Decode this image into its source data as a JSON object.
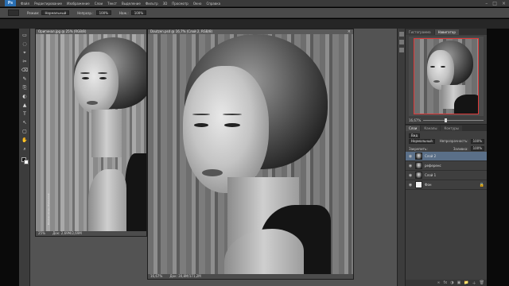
{
  "app": {
    "logo": "Ps",
    "menu": [
      "Файл",
      "Редактирование",
      "Изображение",
      "Слои",
      "Текст",
      "Выделение",
      "Фильтр",
      "3D",
      "Просмотр",
      "Окно",
      "Справка"
    ],
    "window_controls": [
      "–",
      "□",
      "×"
    ]
  },
  "options": {
    "mode_label": "Режим:",
    "mode_value": "Нормальный",
    "opacity_label": "Непрозр.:",
    "opacity_value": "100%",
    "pressure_label": "Наж.:",
    "flow_value": "100%"
  },
  "tools": [
    "▭",
    "◌",
    "⌖",
    "✂",
    "⌫",
    "✎",
    "⎘",
    "◐",
    "▲",
    "T",
    "↖",
    "▢",
    "✋",
    "⌕"
  ],
  "documents": [
    {
      "title": "Оригинал.jpg @ 25% (RGB/8)",
      "zoom": "25%",
      "status": "Док: 2,69M/2,69M",
      "watermark": "Doutzen Kroes Photoshoot"
    },
    {
      "title": "Doutzen.psd @ 16,7% (Слой 2, RGB/8)",
      "zoom": "16,67%",
      "status": "Док: 30,8M/171,2M"
    }
  ],
  "panels": {
    "tabs_top": [
      "Гистограмма",
      "Навигатор"
    ],
    "active_top": "Навигатор",
    "zoom": "16,67%",
    "zoom_level": 0.35,
    "tabs_layers": [
      "Слои",
      "Каналы",
      "Контуры"
    ],
    "filter_label": "Вид",
    "blend_mode": "Нормальный",
    "opacity_label": "Непрозрачность:",
    "opacity_value": "100%",
    "lock_label": "Закрепить:",
    "fill_label": "Заливка:",
    "fill_value": "100%",
    "layers": [
      {
        "name": "Слой 2",
        "selected": true,
        "thumb": "portrait"
      },
      {
        "name": "референс",
        "selected": false,
        "thumb": "portrait"
      },
      {
        "name": "Слой 1",
        "selected": false,
        "thumb": "portrait"
      },
      {
        "name": "Фон",
        "selected": false,
        "thumb": "white",
        "locked": true
      }
    ],
    "footer_icons": [
      "∞",
      "fx",
      "◑",
      "▣",
      "📁",
      "＋",
      "🗑"
    ]
  }
}
